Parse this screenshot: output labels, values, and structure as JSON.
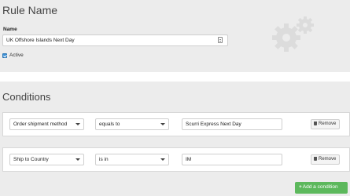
{
  "rule": {
    "title": "Rule Name",
    "name_label": "Name",
    "name_value": "UK Offshore Islands Next Day",
    "active_label": "Active",
    "active_checked": true
  },
  "conditions": {
    "title": "Conditions",
    "rows": [
      {
        "field": "Order shipment method",
        "operator": "equals to",
        "value": "Scurri Express Next Day",
        "remove_label": "Remove"
      },
      {
        "field": "Ship to Country",
        "operator": "is in",
        "value": "IM",
        "remove_label": "Remove"
      }
    ],
    "add_label": "Add a condition"
  },
  "icons": {
    "name_input_icon": "contact-card-icon",
    "decor": "gears-icon",
    "remove": "trash-icon",
    "add": "plus-icon",
    "caret": "chevron-down-icon"
  },
  "colors": {
    "background": "#ececec",
    "accent_checkbox": "#3a8fd6",
    "add_button": "#5cb85c"
  }
}
